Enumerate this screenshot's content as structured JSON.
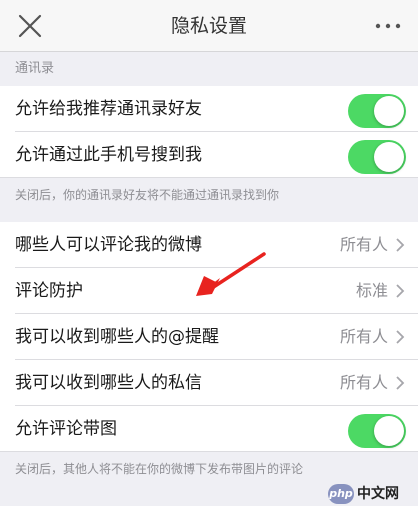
{
  "header": {
    "title": "隐私设置",
    "close_icon": "close-icon",
    "more_icon": "more-icon"
  },
  "sections": {
    "contacts_header": "通讯录",
    "contacts_footnote": "关闭后，你的通讯录好友将不能通过通讯录找到你",
    "images_footnote": "关闭后，其他人将不能在你的微博下发布带图片的评论"
  },
  "rows": {
    "recommend_contacts": {
      "label": "允许给我推荐通讯录好友",
      "enabled": true
    },
    "find_by_phone": {
      "label": "允许通过此手机号搜到我",
      "enabled": true
    },
    "who_can_comment": {
      "label": "哪些人可以评论我的微博",
      "value": "所有人"
    },
    "comment_protection": {
      "label": "评论防护",
      "value": "标准"
    },
    "mentions_from": {
      "label": "我可以收到哪些人的@提醒",
      "value": "所有人"
    },
    "messages_from": {
      "label": "我可以收到哪些人的私信",
      "value": "所有人"
    },
    "comment_images": {
      "label": "允许评论带图",
      "enabled": true
    }
  },
  "watermark": {
    "badge": "php",
    "text": "中文网"
  },
  "colors": {
    "toggle_on": "#4cd964",
    "annotation_arrow": "#e8231f",
    "background": "#efeff4"
  }
}
